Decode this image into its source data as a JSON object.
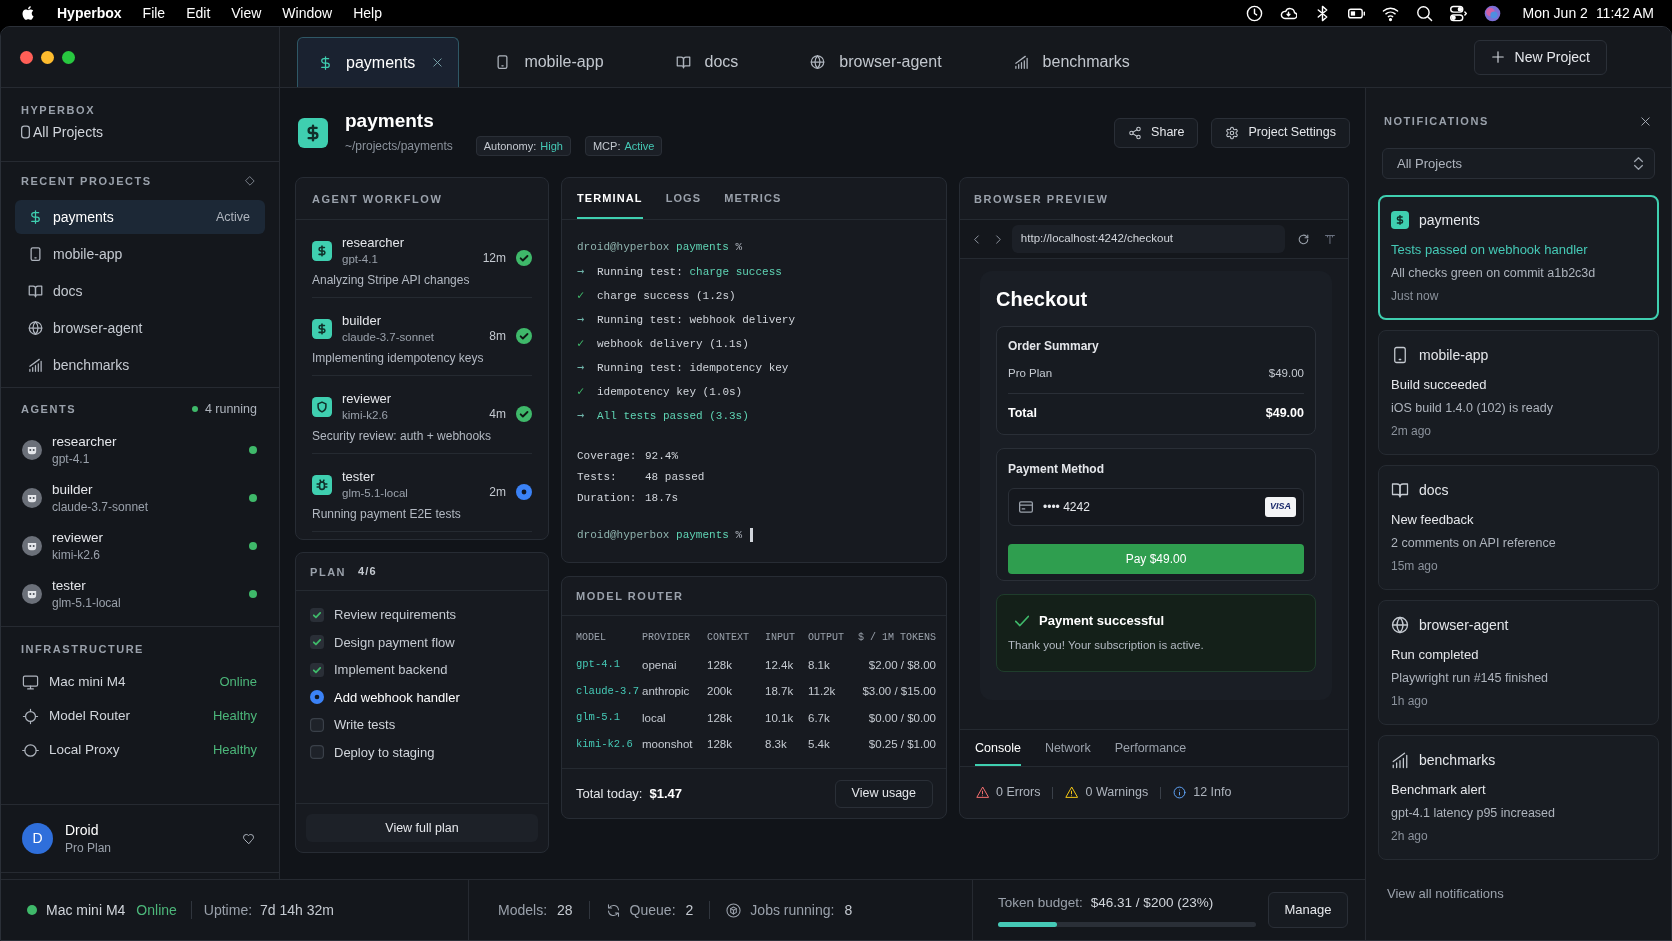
{
  "menu_bar": {
    "app_name": "Hyperbox",
    "menus": [
      "File",
      "Edit",
      "View",
      "Window",
      "Help"
    ],
    "date": "Mon Jun 2",
    "time": "11:42 AM"
  },
  "tabs": [
    {
      "label": "payments",
      "selected": true
    },
    {
      "label": "mobile-app",
      "selected": false
    },
    {
      "label": "docs",
      "selected": false
    },
    {
      "label": "browser-agent",
      "selected": false
    },
    {
      "label": "benchmarks",
      "selected": false
    }
  ],
  "new_project_button": "New Project",
  "sidebar": {
    "brand": "HYPERBOX",
    "all_projects": "All Projects",
    "recent_projects": {
      "title": "RECENT PROJECTS",
      "items": [
        {
          "label": "payments",
          "badge": "Active",
          "selected": true
        },
        {
          "label": "mobile-app",
          "selected": false
        },
        {
          "label": "docs",
          "selected": false
        },
        {
          "label": "browser-agent",
          "selected": false
        },
        {
          "label": "benchmarks",
          "selected": false
        }
      ]
    },
    "agents": {
      "title": "AGENTS",
      "running": "4 running",
      "items": [
        {
          "name": "researcher",
          "model": "gpt-4.1",
          "active": true
        },
        {
          "name": "builder",
          "model": "claude-3.7-sonnet",
          "active": true
        },
        {
          "name": "reviewer",
          "model": "kimi-k2.6",
          "active": true
        },
        {
          "name": "tester",
          "model": "glm-5.1-local",
          "active": true
        }
      ]
    },
    "infrastructure": {
      "title": "INFRASTRUCTURE",
      "items": [
        {
          "name": "Mac mini M4",
          "status": "Online"
        },
        {
          "name": "Model Router",
          "status": "Healthy"
        },
        {
          "name": "Local Proxy",
          "status": "Healthy"
        }
      ]
    },
    "user": {
      "initial": "D",
      "name": "Droid",
      "plan": "Pro Plan"
    }
  },
  "project": {
    "name": "payments",
    "path": "~/projects/payments",
    "badges": [
      {
        "label": "Autonomy:",
        "value": "High"
      },
      {
        "label": "MCP:",
        "value": "Active"
      }
    ],
    "actions": [
      "Share",
      "Project Settings"
    ]
  },
  "agent_workflow": {
    "title": "AGENT WORKFLOW",
    "items": [
      {
        "name": "researcher",
        "model": "gpt-4.1",
        "time": "12m",
        "task": "Analyzing Stripe API changes",
        "completed": true
      },
      {
        "name": "builder",
        "model": "claude-3.7-sonnet",
        "time": "8m",
        "task": "Implementing idempotency keys",
        "completed": true
      },
      {
        "name": "reviewer",
        "model": "kimi-k2.6",
        "time": "4m",
        "task": "Security review: auth + webhooks",
        "completed": true
      },
      {
        "name": "tester",
        "model": "glm-5.1-local",
        "time": "2m",
        "task": "Running payment E2E tests",
        "completed": false
      }
    ]
  },
  "plan": {
    "title": "PLAN",
    "step_count": "4/6",
    "items": [
      {
        "label": "Review requirements",
        "checked": true,
        "current": false
      },
      {
        "label": "Design payment flow",
        "checked": true,
        "current": false
      },
      {
        "label": "Implement backend",
        "checked": true,
        "current": false
      },
      {
        "label": "Add webhook handler",
        "checked": false,
        "current": true
      },
      {
        "label": "Write tests",
        "checked": false,
        "current": false
      },
      {
        "label": "Deploy to staging",
        "checked": false,
        "current": false
      }
    ],
    "button": "View full plan"
  },
  "terminal": {
    "tabs": [
      {
        "label": "TERMINAL",
        "selected": true
      },
      {
        "label": "LOGS",
        "selected": false
      },
      {
        "label": "METRICS",
        "selected": false
      }
    ],
    "command_prompt": {
      "user": "droid@hyperbox",
      "directory": "payments",
      "symbol": "%"
    },
    "lines": [
      {
        "kind": "run",
        "marker": "→",
        "text": "Running test:",
        "highlight": "charge success"
      },
      {
        "kind": "pass",
        "marker": "✓",
        "text": "charge success (1.2s)"
      },
      {
        "kind": "run",
        "marker": "→",
        "text": "Running test: webhook delivery"
      },
      {
        "kind": "pass",
        "marker": "✓",
        "text": "webhook delivery (1.1s)"
      },
      {
        "kind": "run",
        "marker": "→",
        "text": "Running test: idempotency key"
      },
      {
        "kind": "pass",
        "marker": "✓",
        "text": "idempotency key (1.0s)"
      },
      {
        "kind": "done",
        "marker": "→",
        "text": "All tests passed (3.3s)"
      }
    ],
    "stats": [
      {
        "label": "Coverage:",
        "value": "92.4%"
      },
      {
        "label": "Tests:",
        "value": "48 passed"
      },
      {
        "label": "Duration:",
        "value": "18.7s"
      }
    ],
    "input_prompt": {
      "user": "droid@hyperbox",
      "directory": "payments",
      "symbol": "%",
      "cursor": true
    }
  },
  "model_router": {
    "title": "MODEL ROUTER",
    "columns": [
      "MODEL",
      "PROVIDER",
      "CONTEXT",
      "INPUT",
      "OUTPUT",
      "$ / 1M TOKENS"
    ],
    "rows": [
      [
        "gpt-4.1",
        "openai",
        "128k",
        "12.4k",
        "8.1k",
        "$2.00 / $8.00"
      ],
      [
        "claude-3.7",
        "anthropic",
        "200k",
        "18.7k",
        "11.2k",
        "$3.00 / $15.00"
      ],
      [
        "glm-5.1",
        "local",
        "128k",
        "10.1k",
        "6.7k",
        "$0.00 / $0.00"
      ],
      [
        "kimi-k2.6",
        "moonshot",
        "128k",
        "8.3k",
        "5.4k",
        "$0.25 / $1.00"
      ]
    ],
    "total_label": "Total today:",
    "total_value": "$1.47",
    "button": "View usage"
  },
  "browser_preview": {
    "title": "BROWSER PREVIEW",
    "url": "http://localhost:4242/checkout",
    "page": {
      "heading": "Checkout",
      "order_summary": {
        "title": "Order Summary",
        "items": [
          {
            "label": "Pro Plan",
            "value": "$49.00"
          }
        ],
        "total_label": "Total",
        "total_value": "$49.00"
      },
      "payment_method": {
        "title": "Payment Method",
        "card_number": "•••• 4242",
        "card_brand": "VISA"
      },
      "pay_button": "Pay $49.00",
      "success": {
        "title": "Payment successful",
        "message": "Thank you! Your subscription is active."
      }
    },
    "devtools_tabs": [
      {
        "label": "Console",
        "selected": true
      },
      {
        "label": "Network",
        "selected": false
      },
      {
        "label": "Performance",
        "selected": false
      }
    ],
    "console_counts": [
      {
        "kind": "error",
        "label": "0 Errors"
      },
      {
        "kind": "warning",
        "label": "0 Warnings"
      },
      {
        "kind": "info",
        "label": "12 Info"
      }
    ]
  },
  "notifications": {
    "title": "NOTIFICATIONS",
    "filter": "All Projects",
    "items": [
      {
        "project": "payments",
        "title": "Tests passed on webhook handler",
        "message": "All checks green on commit a1b2c3d",
        "time": "Just now",
        "selected": true
      },
      {
        "project": "mobile-app",
        "title": "Build succeeded",
        "message": "iOS build 1.4.0 (102) is ready",
        "time": "2m ago",
        "selected": false
      },
      {
        "project": "docs",
        "title": "New feedback",
        "message": "2 comments on API reference",
        "time": "15m ago",
        "selected": false
      },
      {
        "project": "browser-agent",
        "title": "Run completed",
        "message": "Playwright run #145 finished",
        "time": "1h ago",
        "selected": false
      },
      {
        "project": "benchmarks",
        "title": "Benchmark alert",
        "message": "gpt-4.1 latency p95 increased",
        "time": "2h ago",
        "selected": false
      }
    ],
    "footer": "View all notifications"
  },
  "status_bar": {
    "machine": "Mac mini M4",
    "machine_status": "Online",
    "uptime_label": "Uptime:",
    "uptime": "7d 14h 32m",
    "stats": [
      {
        "kind": "models",
        "label": "Models:",
        "value": "28"
      },
      {
        "kind": "queue",
        "label": "Queue:",
        "value": "2"
      },
      {
        "kind": "jobs",
        "label": "Jobs running:",
        "value": "8"
      }
    ],
    "token_budget": {
      "label": "Token budget:",
      "value": "$46.31 / $200 (23%)",
      "level": 0.23
    },
    "button": "Manage"
  }
}
